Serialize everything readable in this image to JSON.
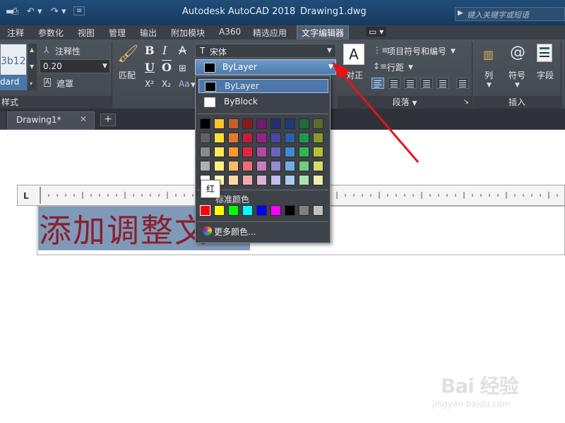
{
  "title_bar": {
    "app_title": "Autodesk AutoCAD 2018",
    "doc_title": "Drawing1.dwg",
    "search_placeholder": "键入关键字或短语"
  },
  "ribbon_tabs": [
    {
      "label": "注释"
    },
    {
      "label": "参数化"
    },
    {
      "label": "视图"
    },
    {
      "label": "管理"
    },
    {
      "label": "输出"
    },
    {
      "label": "附加模块"
    },
    {
      "label": "A360"
    },
    {
      "label": "精选应用"
    },
    {
      "label": "文字编辑器",
      "active": true
    }
  ],
  "ribbon": {
    "style_preview_text": "3b12",
    "style_preview_name": "dard",
    "annotative_label": "注释性",
    "text_height_value": "0.20",
    "mask_label": "遮罩",
    "style_panel_label": "样式",
    "match_label": "匹配",
    "font_value": "宋体",
    "color_value": "ByLayer",
    "justify_label": "对正",
    "bullets_label": "项目符号和编号",
    "line_spacing_label": "行距",
    "paragraph_panel_label": "段落",
    "column_label": "列",
    "symbol_label": "符号",
    "field_label": "字段",
    "insert_panel_label": "插入",
    "superscript_label": "X²",
    "subscript_label": "X₂",
    "case_label": "Aa"
  },
  "file_tab": {
    "label": "Drawing1*",
    "close": "✕",
    "new_tab": "+"
  },
  "editor": {
    "ruler_corner": "L",
    "text": "添加调整文"
  },
  "color_dropdown": {
    "items": [
      {
        "label": "ByLayer",
        "color": "#000000",
        "selected": true
      },
      {
        "label": "ByBlock",
        "color": "#ffffff",
        "selected": false
      }
    ],
    "grid_rows": [
      [
        "#000000",
        "#f7c52f",
        "#c4612e",
        "#8b1a1a",
        "#6f1a6b",
        "#2d2d6e",
        "#1d3a7a",
        "#1e6b3d",
        "#5c6b2a"
      ],
      [
        "#606060",
        "#ffdd33",
        "#e8772e",
        "#c21c3a",
        "#99208a",
        "#4b46a3",
        "#2b5ea8",
        "#1e9a4a",
        "#8b9a2a"
      ],
      [
        "#8a8a8a",
        "#ffea55",
        "#ff9a2a",
        "#e8253a",
        "#b845a8",
        "#6e63c4",
        "#3d8ad6",
        "#2fb84f",
        "#b8c22e"
      ],
      [
        "#b0b0b0",
        "#fff07a",
        "#ffb86a",
        "#ef6a72",
        "#cc7bc0",
        "#958bd6",
        "#70aee6",
        "#6ccf7a",
        "#d6dd6a"
      ],
      [
        "#ffffff",
        "#fff7bb",
        "#ffd7a8",
        "#f4a7ad",
        "#e0b0da",
        "#c2bdea",
        "#a9cdf0",
        "#aae3b2",
        "#ecefad"
      ]
    ],
    "standard_label": "标准颜色",
    "standard_colors": [
      "#ff0000",
      "#ffff00",
      "#00ff00",
      "#00ffff",
      "#0000ff",
      "#ff00ff",
      "#000000",
      "#808080",
      "#c0c0c0"
    ],
    "more_colors_label": "更多颜色..."
  },
  "tooltip": {
    "text": "红"
  },
  "watermark": {
    "brand": "Bai 经验",
    "sub": "jingyan.baidu.com"
  }
}
